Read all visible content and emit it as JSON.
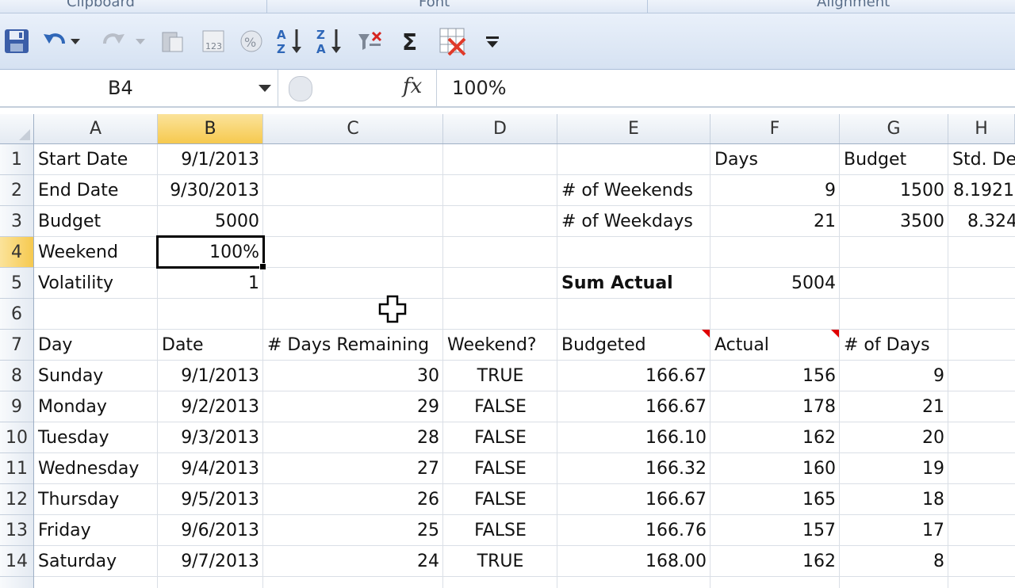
{
  "ribbon": {
    "groups": [
      "Clipboard",
      "Font",
      "Alignment"
    ]
  },
  "quick_access": {
    "buttons": [
      "save-icon",
      "undo-icon",
      "undo-dropdown-icon",
      "redo-icon",
      "redo-dropdown-icon",
      "paste-icon",
      "number-format-icon",
      "percent-style-icon",
      "sort-ascending-icon",
      "sort-descending-icon",
      "clear-filter-icon",
      "autosum-icon",
      "delete-icon",
      "customize-qat-icon"
    ]
  },
  "formula_bar": {
    "name_box": "B4",
    "fx_label": "fx",
    "formula": "100%"
  },
  "columns": [
    "A",
    "B",
    "C",
    "D",
    "E",
    "F",
    "G",
    "H"
  ],
  "selected_column": "B",
  "rows": [
    "1",
    "2",
    "3",
    "4",
    "5",
    "6",
    "7",
    "8",
    "9",
    "10",
    "11",
    "12",
    "13",
    "14"
  ],
  "selected_row": "4",
  "cells": {
    "r1": {
      "A": "Start Date",
      "B": "9/1/2013",
      "F": "Days",
      "G": "Budget",
      "H": "Std. De"
    },
    "r2": {
      "A": "End Date",
      "B": "9/30/2013",
      "E": "# of Weekends",
      "F": "9",
      "G": "1500",
      "H": "8.1921"
    },
    "r3": {
      "A": "Budget",
      "B": "5000",
      "E": "# of Weekdays",
      "F": "21",
      "G": "3500",
      "H": "8.324"
    },
    "r4": {
      "A": "Weekend",
      "B": "100%"
    },
    "r5": {
      "A": "Volatility",
      "B": "1",
      "E": "Sum Actual",
      "F": "5004"
    },
    "r7": {
      "A": "Day",
      "B": "Date",
      "C": "# Days Remaining",
      "D": "Weekend?",
      "E": "Budgeted",
      "F": "Actual",
      "G": "# of Days"
    },
    "r8": {
      "A": "Sunday",
      "B": "9/1/2013",
      "C": "30",
      "D": "TRUE",
      "E": "166.67",
      "F": "156",
      "G": "9"
    },
    "r9": {
      "A": "Monday",
      "B": "9/2/2013",
      "C": "29",
      "D": "FALSE",
      "E": "166.67",
      "F": "178",
      "G": "21"
    },
    "r10": {
      "A": "Tuesday",
      "B": "9/3/2013",
      "C": "28",
      "D": "FALSE",
      "E": "166.10",
      "F": "162",
      "G": "20"
    },
    "r11": {
      "A": "Wednesday",
      "B": "9/4/2013",
      "C": "27",
      "D": "FALSE",
      "E": "166.32",
      "F": "160",
      "G": "19"
    },
    "r12": {
      "A": "Thursday",
      "B": "9/5/2013",
      "C": "26",
      "D": "FALSE",
      "E": "166.67",
      "F": "165",
      "G": "18"
    },
    "r13": {
      "A": "Friday",
      "B": "9/6/2013",
      "C": "25",
      "D": "FALSE",
      "E": "166.76",
      "F": "157",
      "G": "17"
    },
    "r14": {
      "A": "Saturday",
      "B": "9/7/2013",
      "C": "24",
      "D": "TRUE",
      "E": "168.00",
      "F": "162",
      "G": "8"
    }
  }
}
